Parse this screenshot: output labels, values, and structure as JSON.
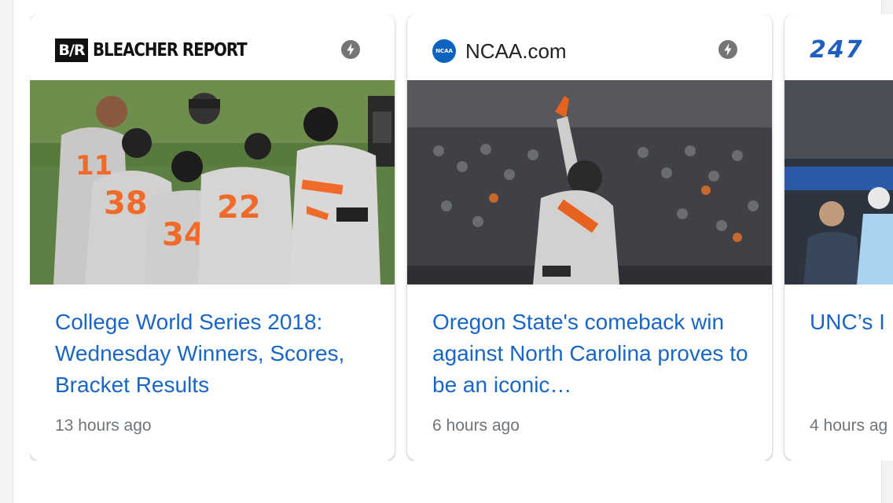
{
  "cards": [
    {
      "source": "BLEACHER REPORT",
      "logo_text": "B/R",
      "icon": "amp-lightning-icon",
      "headline": "College World Series 2018: Wednesday Winners, Scores, Bracket Results",
      "time": "13 hours ago",
      "jersey_numbers": [
        "11",
        "38",
        "22",
        "34"
      ]
    },
    {
      "source": "NCAA.com",
      "logo_text": "NCAA",
      "icon": "amp-lightning-icon",
      "headline": "Oregon State's comeback win against North Carolina proves to be an iconic…",
      "time": "6 hours ago"
    },
    {
      "source": "247",
      "headline": "UNC’s I",
      "time": "4 hours ag"
    }
  ],
  "colors": {
    "link": "#1a66c4",
    "meta": "#70757a",
    "ncaa_blue": "#0b63bf",
    "logo_247_blue": "#1f5fbf",
    "logo_247_green": "#39b54a",
    "orange": "#f06a2a"
  }
}
